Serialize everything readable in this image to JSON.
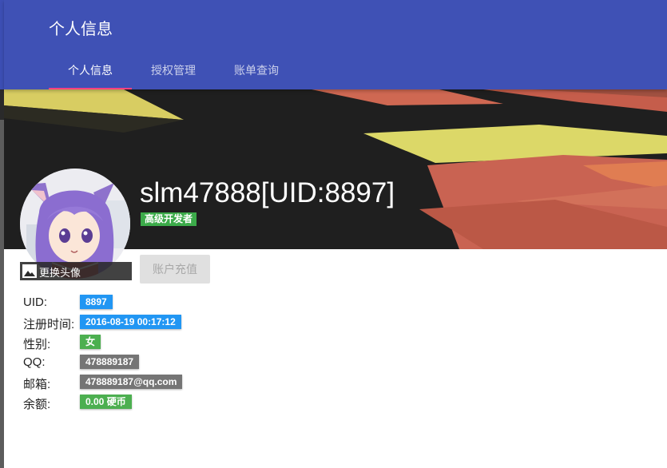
{
  "header": {
    "title": "个人信息",
    "tabs": [
      {
        "label": "个人信息",
        "active": true
      },
      {
        "label": "授权管理",
        "active": false
      },
      {
        "label": "账单查询",
        "active": false
      }
    ]
  },
  "profile": {
    "username": "slm47888[UID:8897]",
    "role": "高级开发者",
    "change_avatar_label": "更换头像",
    "recharge_label": "账户充值"
  },
  "info": {
    "uid": {
      "label": "UID:",
      "value": "8897"
    },
    "register_time": {
      "label": "注册时间:",
      "value": "2016-08-19 00:17:12"
    },
    "gender": {
      "label": "性别:",
      "value": "女"
    },
    "qq": {
      "label": "QQ:",
      "value": "478889187"
    },
    "email": {
      "label": "邮箱:",
      "value": "478889187@qq.com"
    },
    "balance": {
      "label": "余额:",
      "value": "0.00 硬币"
    }
  },
  "colors": {
    "primary": "#3f51b5",
    "accent": "#ff4081",
    "badge_blue": "#2196f3",
    "badge_green": "#4caf50",
    "badge_grey": "#757575"
  },
  "icons": {
    "change_avatar": "image-icon"
  }
}
